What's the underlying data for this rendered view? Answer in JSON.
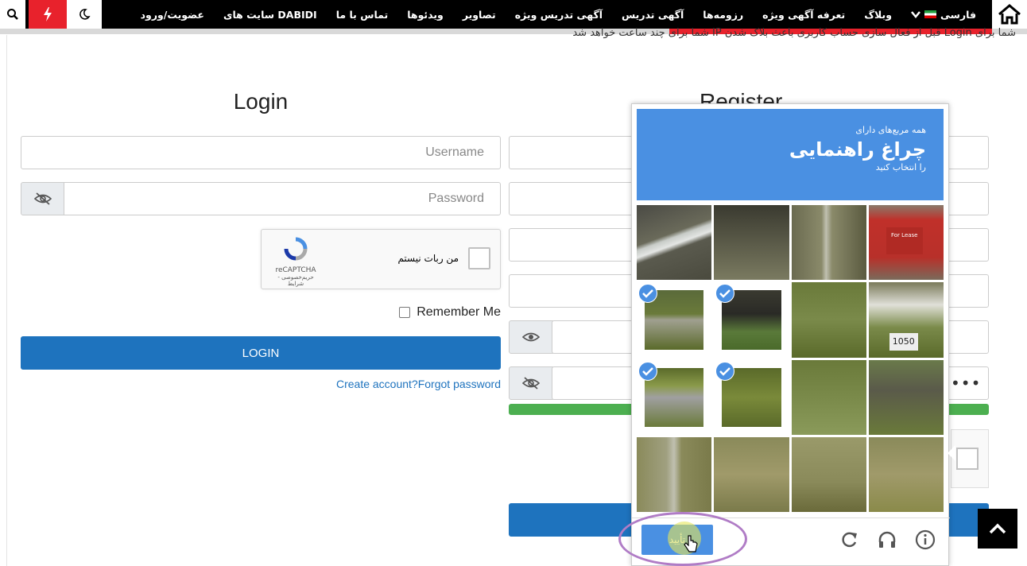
{
  "nav": {
    "items": [
      "فارسی",
      "وبلاگ",
      "تعرفه آگهی ویژه",
      "رزومه‌ها",
      "آگهی تدریس",
      "آگهی تدریس ویژه",
      "تصاویر",
      "ویدئوها",
      "تماس با ما",
      "سایت های DABIDI",
      "عضویت/ورود"
    ]
  },
  "notice": "شما برای Login قبل از فعال سازی حساب کاربری باعث بلاک شدن IP شما برای چند ساعت خواهد شد",
  "login": {
    "title": "Login",
    "username_placeholder": "Username",
    "password_placeholder": "Password",
    "recaptcha_label": "من ربات نیستم",
    "recaptcha_brand": "reCAPTCHA",
    "recaptcha_terms": "حریم‌خصوصی - شرایط",
    "remember_label": "Remember Me",
    "login_button": "LOGIN",
    "create_link": "Create account?",
    "forgot_link": "Forgot password"
  },
  "register": {
    "title": "Register",
    "password_dots": "•••"
  },
  "challenge": {
    "line1": "همه مربع‌های دارای",
    "line2": "چراغ راهنمایی",
    "line3": "را انتخاب کنید",
    "verify_button": "تأیید",
    "sign_text": "For Lease",
    "sign_number": "1050",
    "selected_tiles": [
      4,
      5,
      8,
      9
    ]
  },
  "colors": {
    "accent_blue": "#1e73be",
    "challenge_blue": "#4a90e2",
    "nav_red": "#e8222c",
    "strength_green": "#4caf50"
  }
}
